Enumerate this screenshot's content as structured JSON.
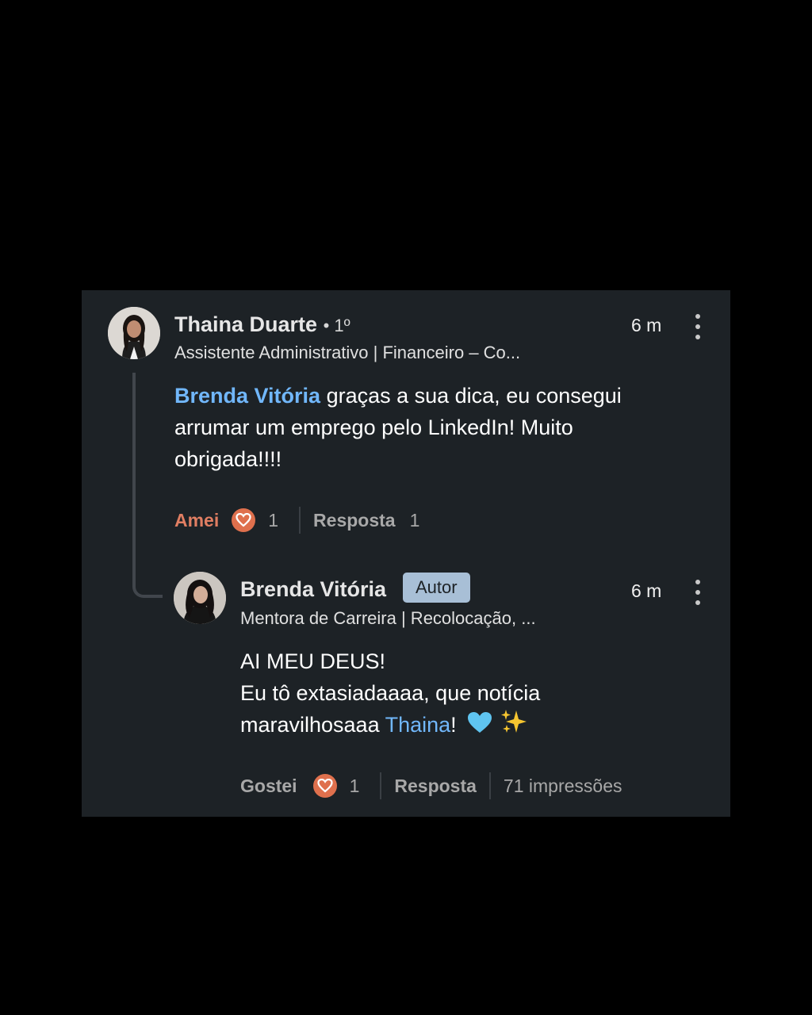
{
  "comment": {
    "author": "Thaina Duarte",
    "degree": "• 1º",
    "headline": "Assistente Administrativo | Financeiro – Co...",
    "time": "6 m",
    "mention": "Brenda Vitória",
    "text_after_mention_line1": " graças a sua dica, eu consegui",
    "text_line2": "arrumar um emprego pelo LinkedIn! Muito",
    "text_line3": "obrigada!!!!",
    "reaction_label": "Amei",
    "reaction_count": "1",
    "reply_label": "Resposta",
    "reply_count": "1"
  },
  "reply": {
    "author": "Brenda Vitória",
    "badge": "Autor",
    "headline": "Mentora de Carreira | Recolocação, ...",
    "time": "6 m",
    "text_line1": "AI MEU DEUS!",
    "text_line2": "Eu tô extasiadaaaa, que notícia",
    "text_line3_before": "maravilhosaaa ",
    "mention": "Thaina",
    "text_line3_after": "!",
    "reaction_label": "Gostei",
    "reaction_count": "1",
    "reply_label": "Resposta",
    "impressions": "71 impressões"
  },
  "icons": {
    "reaction": "heart-reaction-icon",
    "more": "more-vertical-icon",
    "emoji_heart": "blue-heart-emoji",
    "emoji_sparkles": "sparkles-emoji"
  },
  "colors": {
    "card_bg": "#1d2226",
    "mention": "#71b7fb",
    "love_reaction": "#df704d",
    "badge_bg": "#a8bfd6"
  }
}
